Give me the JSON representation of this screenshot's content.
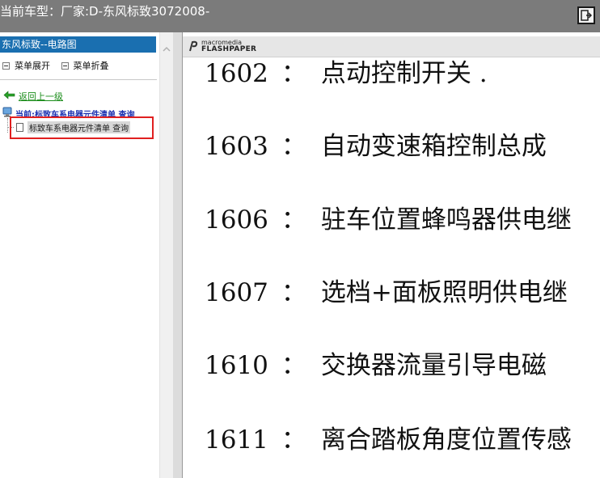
{
  "topbar": {
    "title": "当前车型：厂家:D-东风标致3072008-",
    "exit_icon": "exit-icon"
  },
  "sidebar": {
    "header": "东风标致--电路图",
    "expand_label": "菜单展开",
    "collapse_label": "菜单折叠",
    "back_label": "返回上一级",
    "current_label": "当前:标致车系电器元件清单 查询",
    "child_label": "标致车系电器元件清单 查询"
  },
  "viewer": {
    "logo_small": "macromedia",
    "logo_big": "FLASHPAPER",
    "separator": "：",
    "entries": [
      {
        "code": "1602",
        "text": "点动控制开关 ."
      },
      {
        "code": "1603",
        "text": "自动变速箱控制总成"
      },
      {
        "code": "1606",
        "text": "驻车位置蜂鸣器供电继"
      },
      {
        "code": "1607",
        "text": "选档+面板照明供电继"
      },
      {
        "code": "1610",
        "text": "交换器流量引导电磁"
      },
      {
        "code": "1611",
        "text": "离合踏板角度位置传感"
      }
    ]
  }
}
